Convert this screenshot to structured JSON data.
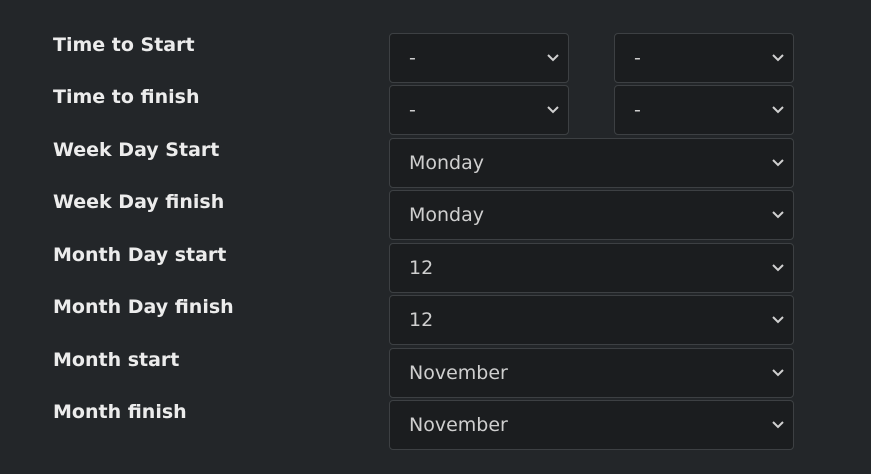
{
  "rows": [
    {
      "label": "Time to Start",
      "values": [
        "-",
        "-"
      ]
    },
    {
      "label": "Time to finish",
      "values": [
        "-",
        "-"
      ]
    },
    {
      "label": "Week Day Start",
      "value": "Monday"
    },
    {
      "label": "Week Day finish",
      "value": "Monday"
    },
    {
      "label": "Month Day start",
      "value": "12"
    },
    {
      "label": "Month Day finish",
      "value": "12"
    },
    {
      "label": "Month start",
      "value": "November"
    },
    {
      "label": "Month finish",
      "value": "November"
    }
  ],
  "icons": {
    "dropdown": "chevron-down-icon"
  },
  "colors": {
    "background": "#232629",
    "field": "#1b1d1f",
    "label": "#ececec",
    "value": "#cfcfcf"
  }
}
